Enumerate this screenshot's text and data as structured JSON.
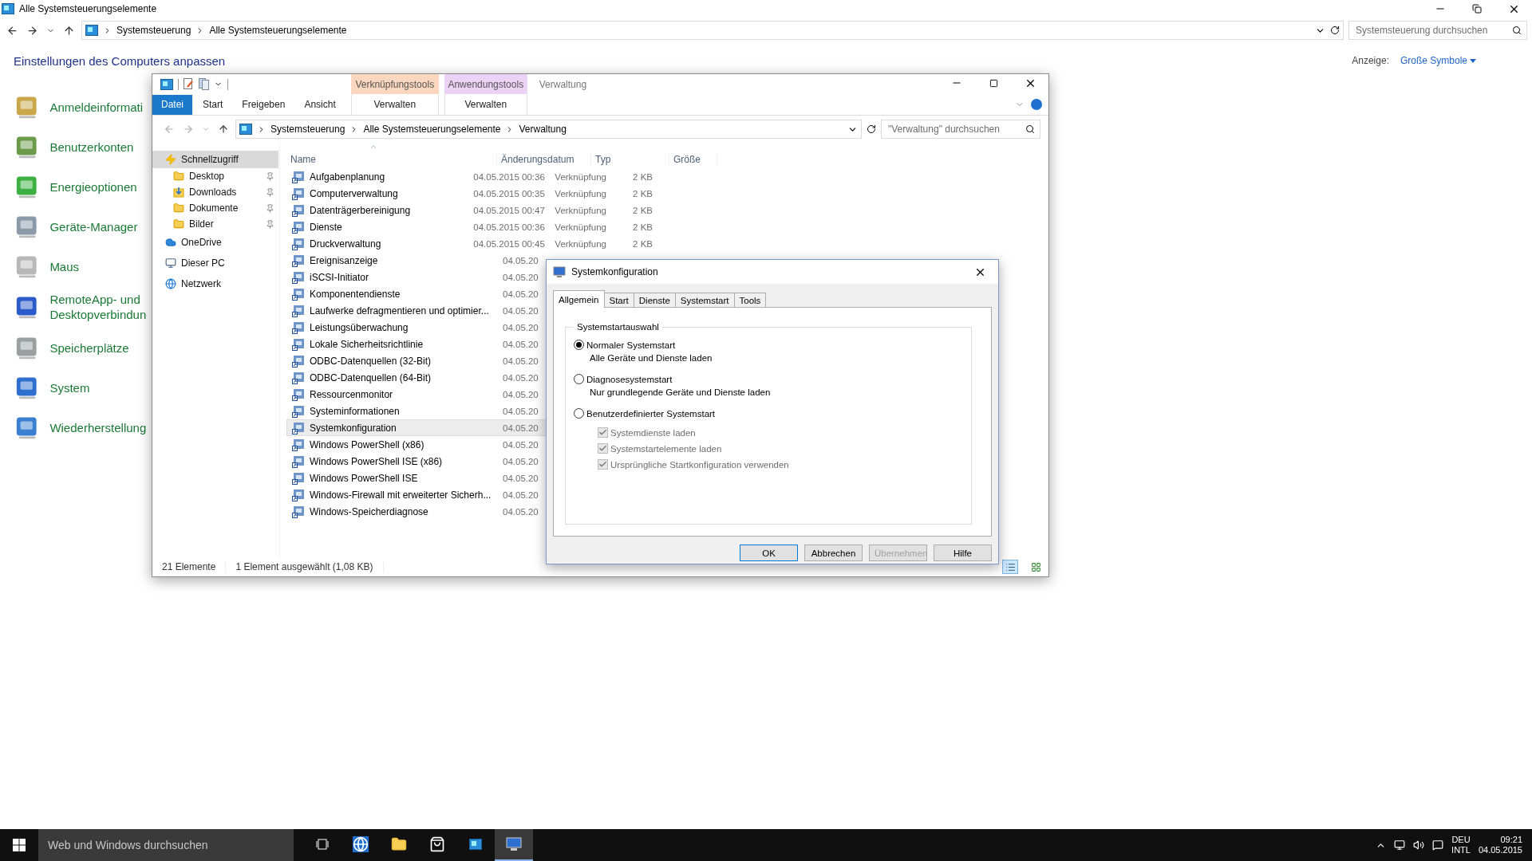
{
  "control_panel": {
    "title": "Alle Systemsteuerungselemente",
    "path": [
      "Systemsteuerung",
      "Alle Systemsteuerungselemente"
    ],
    "search": {
      "placeholder": "Systemsteuerung durchsuchen"
    },
    "heading": "Einstellungen des Computers anpassen",
    "view_label": "Anzeige:",
    "view_value": "Große Symbole",
    "items": [
      {
        "label": "Anmeldeinformati",
        "color": "#c9a74a"
      },
      {
        "label": "Benutzerkonten",
        "color": "#6a9a4a"
      },
      {
        "label": "Energieoptionen",
        "color": "#3cb043"
      },
      {
        "label": "Geräte-Manager",
        "color": "#8a9aa8"
      },
      {
        "label": "Maus",
        "color": "#b8b8b8"
      },
      {
        "label": "RemoteApp- und Desktopverbindun",
        "color": "#2a5bc8"
      },
      {
        "label": "Speicherplätze",
        "color": "#9aa0a0"
      },
      {
        "label": "System",
        "color": "#2f6fd0"
      },
      {
        "label": "Wiederherstellung",
        "color": "#3a7fd0"
      }
    ]
  },
  "explorer": {
    "title": "Verwaltung",
    "context_groups": [
      {
        "label": "Verknüpfungstools",
        "color": "#fbd7bf",
        "tab": "Verwalten"
      },
      {
        "label": "Anwendungstools",
        "color": "#ecd2f5",
        "tab": "Verwalten"
      }
    ],
    "tabs": [
      {
        "label": "Datei",
        "kind": "file"
      },
      {
        "label": "Start",
        "kind": "plain"
      },
      {
        "label": "Freigeben",
        "kind": "plain"
      },
      {
        "label": "Ansicht",
        "kind": "plain"
      }
    ],
    "path": [
      "Systemsteuerung",
      "Alle Systemsteuerungselemente",
      "Verwaltung"
    ],
    "search": {
      "placeholder": "\"Verwaltung\" durchsuchen"
    },
    "nav": [
      {
        "label": "Schnellzugriff",
        "kind": "quick",
        "selected": true,
        "children": [
          {
            "label": "Desktop",
            "kind": "folder",
            "pinned": true,
            "selected": false
          },
          {
            "label": "Downloads",
            "kind": "download",
            "pinned": true,
            "selected": false
          },
          {
            "label": "Dokumente",
            "kind": "folder",
            "pinned": true,
            "selected": false
          },
          {
            "label": "Bilder",
            "kind": "folder",
            "pinned": true,
            "selected": false
          }
        ]
      },
      {
        "label": "OneDrive",
        "kind": "cloud",
        "selected": false
      },
      {
        "label": "Dieser PC",
        "kind": "pc",
        "selected": false
      },
      {
        "label": "Netzwerk",
        "kind": "network",
        "selected": false
      }
    ],
    "columns": [
      "Name",
      "Änderungsdatum",
      "Typ",
      "Größe"
    ],
    "rows": [
      {
        "name": "Aufgabenplanung",
        "date": "04.05.2015 00:36",
        "type": "Verknüpfung",
        "size": "2 KB",
        "selected": false
      },
      {
        "name": "Computerverwaltung",
        "date": "04.05.2015 00:35",
        "type": "Verknüpfung",
        "size": "2 KB",
        "selected": false
      },
      {
        "name": "Datenträgerbereinigung",
        "date": "04.05.2015 00:47",
        "type": "Verknüpfung",
        "size": "2 KB",
        "selected": false
      },
      {
        "name": "Dienste",
        "date": "04.05.2015 00:36",
        "type": "Verknüpfung",
        "size": "2 KB",
        "selected": false
      },
      {
        "name": "Druckverwaltung",
        "date": "04.05.2015 00:45",
        "type": "Verknüpfung",
        "size": "2 KB",
        "selected": false
      },
      {
        "name": "Ereignisanzeige",
        "date": "04.05.20",
        "selected": false
      },
      {
        "name": "iSCSI-Initiator",
        "date": "04.05.20",
        "selected": false
      },
      {
        "name": "Komponentendienste",
        "date": "04.05.20",
        "selected": false
      },
      {
        "name": "Laufwerke defragmentieren und optimier...",
        "date": "04.05.20",
        "selected": false
      },
      {
        "name": "Leistungsüberwachung",
        "date": "04.05.20",
        "selected": false
      },
      {
        "name": "Lokale Sicherheitsrichtlinie",
        "date": "04.05.20",
        "selected": false
      },
      {
        "name": "ODBC-Datenquellen (32-Bit)",
        "date": "04.05.20",
        "selected": false
      },
      {
        "name": "ODBC-Datenquellen (64-Bit)",
        "date": "04.05.20",
        "selected": false
      },
      {
        "name": "Ressourcenmonitor",
        "date": "04.05.20",
        "selected": false
      },
      {
        "name": "Systeminformationen",
        "date": "04.05.20",
        "selected": false
      },
      {
        "name": "Systemkonfiguration",
        "date": "04.05.20",
        "selected": true
      },
      {
        "name": "Windows PowerShell (x86)",
        "date": "04.05.20",
        "selected": false
      },
      {
        "name": "Windows PowerShell ISE (x86)",
        "date": "04.05.20",
        "selected": false
      },
      {
        "name": "Windows PowerShell ISE",
        "date": "04.05.20",
        "selected": false
      },
      {
        "name": "Windows-Firewall mit erweiterter Sicherh...",
        "date": "04.05.20",
        "selected": false
      },
      {
        "name": "Windows-Speicherdiagnose",
        "date": "04.05.20",
        "selected": false
      }
    ],
    "status": [
      "21 Elemente",
      "1 Element ausgewählt (1,08 KB)"
    ],
    "views": [
      {
        "kind": "details",
        "selected": true
      },
      {
        "kind": "tiles",
        "selected": false
      }
    ]
  },
  "dialog": {
    "title": "Systemkonfiguration",
    "tabs": [
      {
        "label": "Allgemein",
        "selected": true
      },
      {
        "label": "Start",
        "selected": false
      },
      {
        "label": "Dienste",
        "selected": false
      },
      {
        "label": "Systemstart",
        "selected": false
      },
      {
        "label": "Tools",
        "selected": false
      }
    ],
    "group": "Systemstartauswahl",
    "options": [
      {
        "kind": "radio",
        "label": "Normaler Systemstart",
        "description": "Alle Geräte und Dienste laden",
        "selected": true
      },
      {
        "kind": "radio",
        "label": "Diagnosesystemstart",
        "description": "Nur grundlegende Geräte und Dienste laden",
        "selected": false
      },
      {
        "kind": "radio",
        "label": "Benutzerdefinierter Systemstart",
        "selected": false
      },
      {
        "kind": "checkbox",
        "label": "Systemdienste laden",
        "checked": true,
        "disabled": true
      },
      {
        "kind": "checkbox",
        "label": "Systemstartelemente laden",
        "checked": true,
        "disabled": true
      },
      {
        "kind": "checkbox",
        "label": "Ursprüngliche Startkonfiguration verwenden",
        "checked": true,
        "disabled": true
      }
    ],
    "buttons": [
      {
        "label": "OK",
        "default": true,
        "disabled": false
      },
      {
        "label": "Abbrechen",
        "default": false,
        "disabled": false
      },
      {
        "label": "Übernehmen",
        "default": false,
        "disabled": true
      },
      {
        "label": "Hilfe",
        "default": false,
        "disabled": false
      }
    ]
  },
  "taskbar": {
    "search": {
      "placeholder": "Web und Windows durchsuchen"
    },
    "apps": [
      {
        "kind": "taskview",
        "selected": false
      },
      {
        "kind": "browser",
        "selected": false
      },
      {
        "kind": "explorer",
        "selected": false
      },
      {
        "kind": "store",
        "selected": false
      },
      {
        "kind": "controlpanel",
        "selected": false
      },
      {
        "kind": "msconfig",
        "selected": true
      }
    ],
    "language": [
      "DEU",
      "INTL"
    ],
    "time": "09:21",
    "date": "04.05.2015"
  }
}
